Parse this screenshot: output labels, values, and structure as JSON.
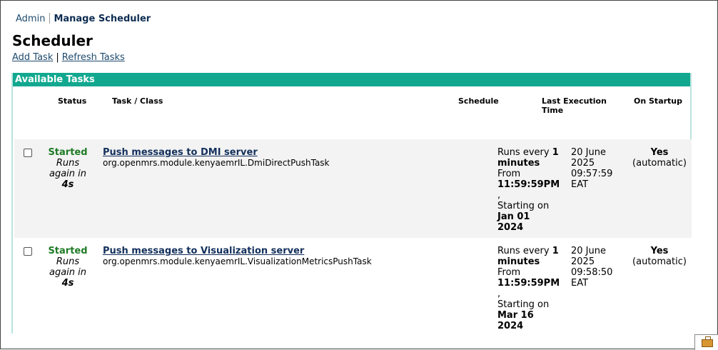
{
  "breadcrumb": {
    "root": "Admin",
    "current": "Manage Scheduler"
  },
  "page_title": "Scheduler",
  "actions": {
    "add_task": "Add Task",
    "separator": "|",
    "refresh_tasks": "Refresh Tasks"
  },
  "panel": {
    "title": "Available Tasks",
    "columns": {
      "status": "Status",
      "task": "Task / Class",
      "schedule": "Schedule",
      "last_exec_1": "Last Execution",
      "last_exec_2": "Time",
      "startup": "On Startup"
    }
  },
  "tasks": [
    {
      "status": "Started",
      "runs_again_1": "Runs",
      "runs_again_2": "again in",
      "runs_again_in": "4s",
      "name": "Push messages to DMI server",
      "class": "org.openmrs.module.kenyaemrIL.DmiDirectPushTask",
      "schedule": {
        "runs_every": "Runs every",
        "interval_value": "1",
        "interval_unit": "minutes",
        "from_label": "From",
        "from_time": "11:59:59PM",
        "comma": ",",
        "starting_label": "Starting on",
        "start_date_1": "Jan 01",
        "start_date_2": "2024"
      },
      "last_execution": {
        "date_1": "20 June",
        "date_2": "2025",
        "time": "09:57:59",
        "tz": "EAT"
      },
      "startup": {
        "value": "Yes",
        "note": "(automatic)"
      }
    },
    {
      "status": "Started",
      "runs_again_1": "Runs",
      "runs_again_2": "again in",
      "runs_again_in": "4s",
      "name": "Push messages to Visualization server",
      "class": "org.openmrs.module.kenyaemrIL.VisualizationMetricsPushTask",
      "schedule": {
        "runs_every": "Runs every",
        "interval_value": "1",
        "interval_unit": "minutes",
        "from_label": "From",
        "from_time": "11:59:59PM",
        "comma": ",",
        "starting_label": "Starting on",
        "start_date_1": "Mar 16",
        "start_date_2": "2024"
      },
      "last_execution": {
        "date_1": "20 June",
        "date_2": "2025",
        "time": "09:58:50",
        "tz": "EAT"
      },
      "startup": {
        "value": "Yes",
        "note": "(automatic)"
      }
    }
  ],
  "colors": {
    "header_bg": "#12a890",
    "status_green": "#1f7a25",
    "link_blue": "#13305c"
  },
  "icons": {
    "corner": "briefcase-icon"
  }
}
